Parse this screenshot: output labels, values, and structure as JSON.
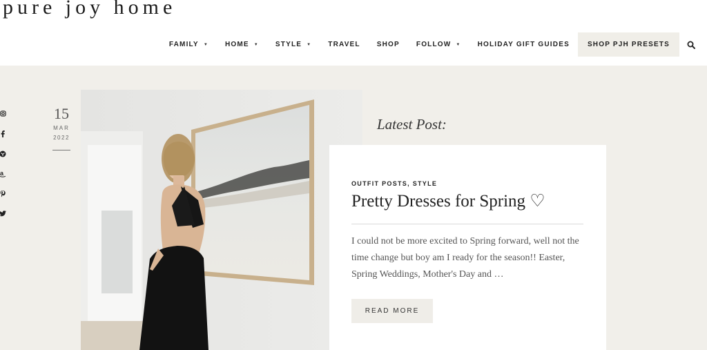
{
  "site": {
    "logo": "pure joy home"
  },
  "nav": {
    "items": [
      {
        "label": "FAMILY"
      },
      {
        "label": "HOME"
      },
      {
        "label": "STYLE"
      },
      {
        "label": "TRAVEL"
      },
      {
        "label": "SHOP"
      },
      {
        "label": "FOLLOW"
      },
      {
        "label": "HOLIDAY GIFT GUIDES"
      },
      {
        "label": "SHOP PJH PRESETS"
      }
    ],
    "dropdown_indicator": "▼",
    "search_icon": "search-icon"
  },
  "social": [
    "instagram-icon",
    "facebook-icon",
    "bloglovin-icon",
    "amazon-icon",
    "pinterest-icon",
    "twitter-icon"
  ],
  "post": {
    "date": {
      "day": "15",
      "month": "MAR",
      "year": "2022"
    },
    "section_label": "Latest Post:",
    "categories": "OUTFIT POSTS, STYLE",
    "title": "Pretty Dresses for Spring ♡",
    "excerpt": "I could not be more excited to Spring forward, well not the time change but boy am I ready for the season!! Easter, Spring Weddings, Mother's Day and …",
    "read_more": "READ MORE"
  },
  "colors": {
    "page_bg": "#f1efea",
    "header_bg": "#ffffff",
    "button_bg": "#efede8",
    "text": "#222222"
  }
}
